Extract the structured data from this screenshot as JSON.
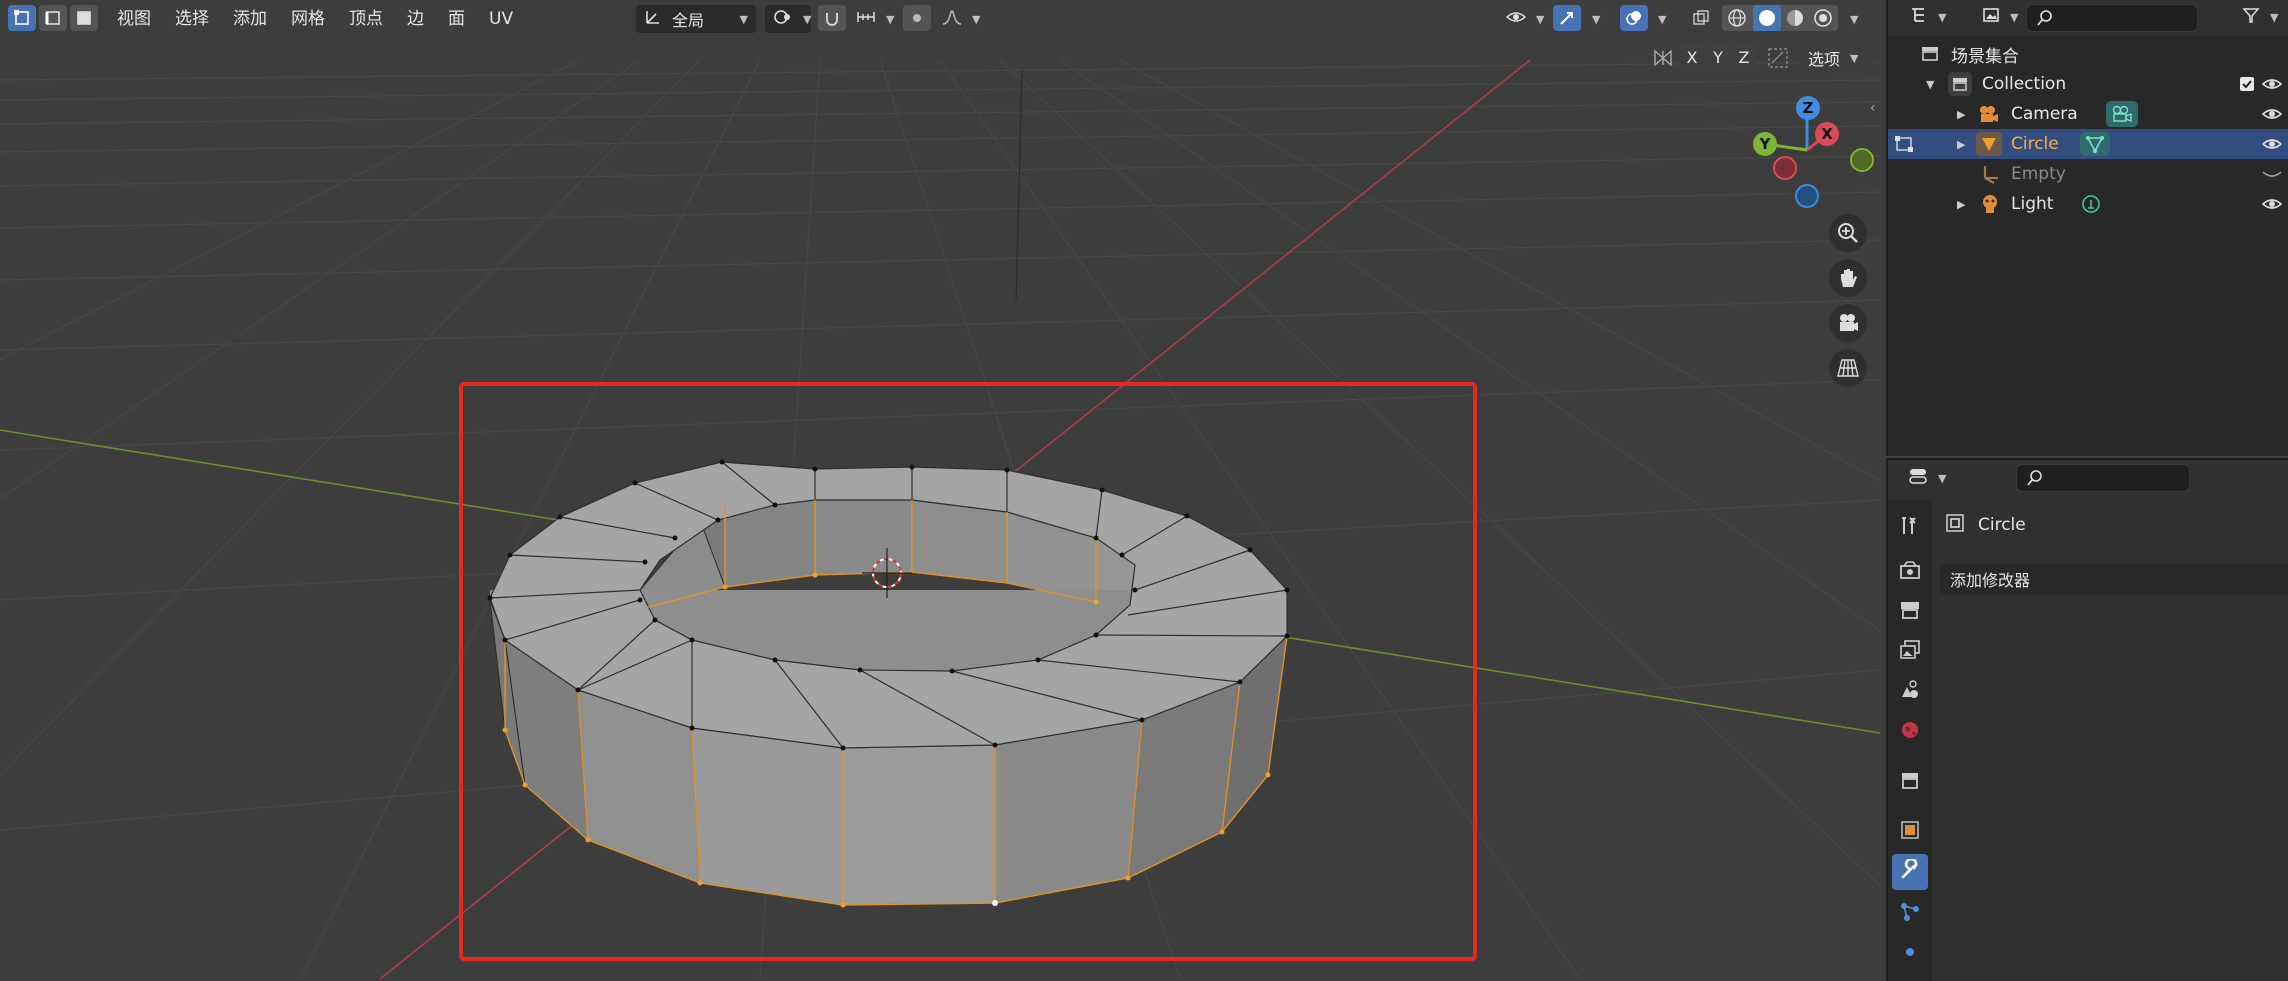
{
  "header": {
    "menus": [
      "视图",
      "选择",
      "添加",
      "网格",
      "顶点",
      "边",
      "面",
      "UV"
    ],
    "transform_orientation": "全局",
    "options_label": "选项",
    "axis_x": "X",
    "axis_y": "Y",
    "axis_z": "Z"
  },
  "gizmo": {
    "x": "X",
    "y": "Y",
    "z": "Z"
  },
  "outliner": {
    "scene_collection": "场景集合",
    "collection": "Collection",
    "items": [
      {
        "label": "Camera",
        "icon": "camera-icon"
      },
      {
        "label": "Circle",
        "icon": "mesh-icon",
        "selected": true
      },
      {
        "label": "Empty",
        "icon": "empty-icon"
      },
      {
        "label": "Light",
        "icon": "light-icon"
      }
    ]
  },
  "properties": {
    "object_name": "Circle",
    "add_modifier": "添加修改器"
  },
  "colors": {
    "accent_blue": "#4772b3",
    "selection_orange": "#f5a623",
    "highlight_red": "#e52b20",
    "axis_x_red": "#d94a5a",
    "axis_y_green": "#7fb534",
    "axis_z_blue": "#3d8ee0"
  }
}
